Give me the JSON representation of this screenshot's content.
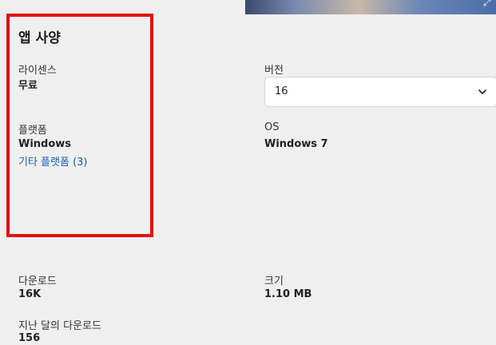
{
  "spec": {
    "title": "앱 사양",
    "license": {
      "label": "라이센스",
      "value": "무료"
    },
    "version": {
      "label": "버전",
      "selected": "16"
    },
    "platform": {
      "label": "플랫폼",
      "value": "Windows",
      "other_link": "기타 플랫폼 (3)"
    },
    "os": {
      "label": "OS",
      "value": "Windows 7"
    },
    "downloads": {
      "label": "다운로드",
      "value": "16K"
    },
    "size": {
      "label": "크기",
      "value": "1.10 MB"
    },
    "last_month_downloads": {
      "label": "지난 달의 다운로드",
      "value": "156"
    }
  },
  "colors": {
    "background": "#efefef",
    "highlight_border": "#e30f0f",
    "link": "#1a5fb4"
  },
  "icons": [
    "chevron-down-icon",
    "expand-icon"
  ]
}
